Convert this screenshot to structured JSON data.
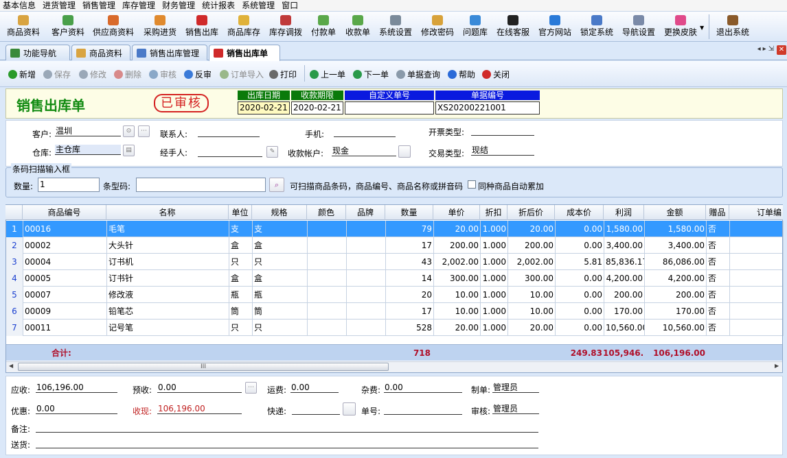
{
  "menu": [
    "基本信息",
    "进货管理",
    "销售管理",
    "库存管理",
    "财务管理",
    "统计报表",
    "系统管理",
    "窗口"
  ],
  "toolbar": [
    {
      "label": "商品资料",
      "icon": "cube-icon",
      "color": "#d9a441"
    },
    {
      "label": "客户资料",
      "icon": "people-icon",
      "color": "#4aa04a"
    },
    {
      "label": "供应商资料",
      "icon": "group-icon",
      "color": "#d96a2b"
    },
    {
      "label": "采购进货",
      "icon": "truck-icon",
      "color": "#e08a2e"
    },
    {
      "label": "销售出库",
      "icon": "basket-icon",
      "color": "#d02a2a"
    },
    {
      "label": "商品库存",
      "icon": "box-icon",
      "color": "#e0b23a"
    },
    {
      "label": "库存调拨",
      "icon": "transfer-icon",
      "color": "#c03a3a"
    },
    {
      "label": "付款单",
      "icon": "pay-icon",
      "color": "#5aa84a"
    },
    {
      "label": "收款单",
      "icon": "receive-icon",
      "color": "#5aa84a"
    },
    {
      "label": "系统设置",
      "icon": "settings-icon",
      "color": "#7a8a9a"
    },
    {
      "label": "修改密码",
      "icon": "pencil-icon",
      "color": "#d8a23a"
    },
    {
      "label": "问题库",
      "icon": "question-icon",
      "color": "#3a8ad8"
    },
    {
      "label": "在线客服",
      "icon": "qq-penguin-icon",
      "color": "#222222"
    },
    {
      "label": "官方网站",
      "icon": "ie-browser-icon",
      "color": "#2a7ad8"
    },
    {
      "label": "锁定系统",
      "icon": "lock-screen-icon",
      "color": "#4a7ac8"
    },
    {
      "label": "导航设置",
      "icon": "nav-icon",
      "color": "#7a8aa8"
    },
    {
      "label": "更换皮肤",
      "icon": "skin-icon",
      "color": "#e04a8a"
    },
    {
      "label": "退出系统",
      "icon": "exit-icon",
      "color": "#8a5a2a"
    }
  ],
  "tabs": [
    {
      "label": "功能导航",
      "icon": "nav-tree-icon",
      "color": "#3a8a3a"
    },
    {
      "label": "商品资料",
      "icon": "cube-icon",
      "color": "#d9a441"
    },
    {
      "label": "销售出库管理",
      "icon": "list-icon",
      "color": "#4a7ac8"
    },
    {
      "label": "销售出库单",
      "icon": "basket-icon",
      "color": "#d02a2a"
    }
  ],
  "actions": [
    {
      "label": "新增",
      "icon": "add-icon",
      "color": "#2a9a2a",
      "enabled": true
    },
    {
      "label": "保存",
      "icon": "save-icon",
      "color": "#9aa8b8",
      "enabled": false
    },
    {
      "label": "修改",
      "icon": "edit-icon",
      "color": "#9aa8b8",
      "enabled": false
    },
    {
      "label": "删除",
      "icon": "delete-icon",
      "color": "#d88a8a",
      "enabled": false
    },
    {
      "label": "审核",
      "icon": "approve-icon",
      "color": "#8aa8c8",
      "enabled": false
    },
    {
      "label": "反审",
      "icon": "unapprove-icon",
      "color": "#3a7ad8",
      "enabled": true
    },
    {
      "label": "订单导入",
      "icon": "import-icon",
      "color": "#9ab88a",
      "enabled": false
    },
    {
      "label": "打印",
      "icon": "print-icon",
      "color": "#6a6a6a",
      "enabled": true
    },
    {
      "label": "上一单",
      "icon": "prev-icon",
      "color": "#2a9a4a",
      "enabled": true
    },
    {
      "label": "下一单",
      "icon": "next-icon",
      "color": "#2a9a4a",
      "enabled": true
    },
    {
      "label": "单据查询",
      "icon": "query-icon",
      "color": "#8a9aaa",
      "enabled": true
    },
    {
      "label": "帮助",
      "icon": "help-icon",
      "color": "#2a6ad8",
      "enabled": true
    },
    {
      "label": "关闭",
      "icon": "close-icon",
      "color": "#d02a2a",
      "enabled": true
    }
  ],
  "header": {
    "title": "销售出库单",
    "stamp": "已审核",
    "out_date_label": "出库日期",
    "out_date": "2020-02-21",
    "due_label": "收款期限",
    "due": "2020-02-21",
    "custom_no_label": "自定义单号",
    "custom_no": "",
    "bill_no_label": "单据编号",
    "bill_no": "XS20200221001"
  },
  "form": {
    "customer_label": "客户:",
    "customer": "温圳",
    "contact_label": "联系人:",
    "contact": "",
    "phone_label": "手机:",
    "phone": "",
    "invoice_label": "开票类型:",
    "invoice": "",
    "warehouse_label": "仓库:",
    "warehouse": "主仓库",
    "handler_label": "经手人:",
    "handler": "",
    "account_label": "收款帐户:",
    "account": "现金",
    "trade_label": "交易类型:",
    "trade": "现结"
  },
  "scan": {
    "legend": "条码扫描输入框",
    "qty_label": "数量:",
    "qty": "1",
    "barcode_label": "条型码:",
    "barcode": "",
    "hint": "可扫描商品条码，商品编号、商品名称或拼音码",
    "merge_label": "同种商品自动累加"
  },
  "grid": {
    "columns": [
      "商品编号",
      "名称",
      "单位",
      "规格",
      "颜色",
      "品牌",
      "数量",
      "单价",
      "折扣",
      "折后价",
      "成本价",
      "利润",
      "金额",
      "赠品",
      "订单编"
    ],
    "rows": [
      [
        "1",
        "00016",
        "毛笔",
        "支",
        "支",
        "",
        "",
        "79",
        "20.00",
        "1.000",
        "20.00",
        "0.00",
        "1,580.00",
        "1,580.00",
        "否"
      ],
      [
        "2",
        "00002",
        "大头针",
        "盒",
        "盒",
        "",
        "",
        "17",
        "200.00",
        "1.000",
        "200.00",
        "0.00",
        "3,400.00",
        "3,400.00",
        "否"
      ],
      [
        "3",
        "00004",
        "订书机",
        "只",
        "只",
        "",
        "",
        "43",
        "2,002.00",
        "1.000",
        "2,002.00",
        "5.81",
        "85,836.17",
        "86,086.00",
        "否"
      ],
      [
        "4",
        "00005",
        "订书针",
        "盒",
        "盒",
        "",
        "",
        "14",
        "300.00",
        "1.000",
        "300.00",
        "0.00",
        "4,200.00",
        "4,200.00",
        "否"
      ],
      [
        "5",
        "00007",
        "修改液",
        "瓶",
        "瓶",
        "",
        "",
        "20",
        "10.00",
        "1.000",
        "10.00",
        "0.00",
        "200.00",
        "200.00",
        "否"
      ],
      [
        "6",
        "00009",
        "铅笔芯",
        "筒",
        "筒",
        "",
        "",
        "17",
        "10.00",
        "1.000",
        "10.00",
        "0.00",
        "170.00",
        "170.00",
        "否"
      ],
      [
        "7",
        "00011",
        "记号笔",
        "只",
        "只",
        "",
        "",
        "528",
        "20.00",
        "1.000",
        "20.00",
        "0.00",
        "10,560.00",
        "10,560.00",
        "否"
      ]
    ],
    "totals": {
      "label": "合计:",
      "qty": "718",
      "cost": "249.83",
      "profit": "105,946.17",
      "amount": "106,196.00"
    },
    "scroll_grip": "III"
  },
  "footer": {
    "receivable_label": "应收:",
    "receivable": "106,196.00",
    "prepaid_label": "预收:",
    "prepaid": "0.00",
    "freight_label": "运费:",
    "freight": "0.00",
    "misc_label": "杂费:",
    "misc": "0.00",
    "maker_label": "制单:",
    "maker": "管理员",
    "discount_label": "优惠:",
    "discount": "0.00",
    "cash_label": "收现:",
    "cash": "106,196.00",
    "express_label": "快递:",
    "express": "",
    "waybill_label": "单号:",
    "waybill": "",
    "auditor_label": "审核:",
    "auditor": "管理员",
    "remark_label": "备注:",
    "remark": "",
    "delivery_label": "送货:",
    "delivery": ""
  }
}
